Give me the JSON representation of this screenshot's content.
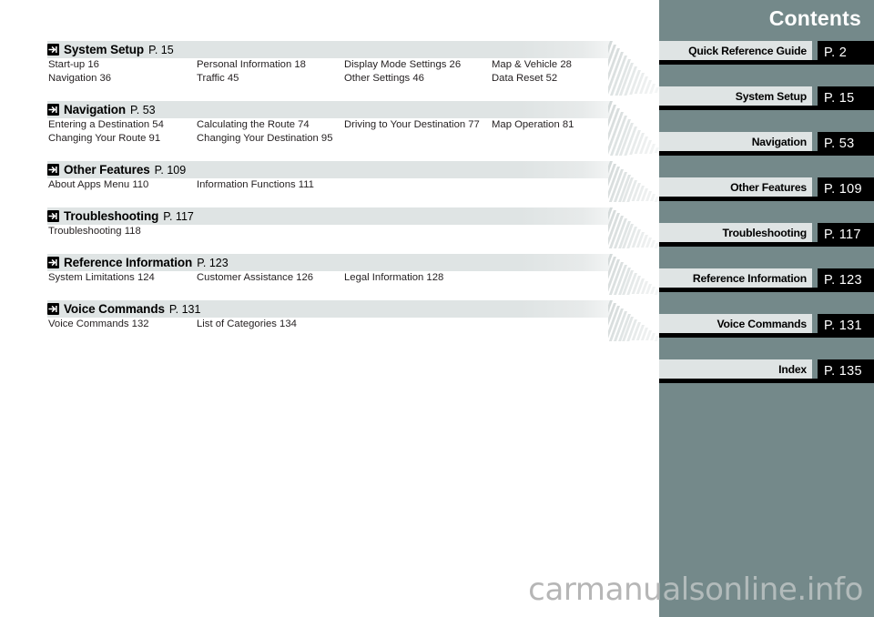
{
  "sidebar": {
    "title": "Contents",
    "background_color": "#74898a",
    "label_color": "#dfe4e4",
    "page_block_color": "#000000",
    "tabs": [
      {
        "label": "Quick Reference Guide",
        "page": "P. 2"
      },
      {
        "label": "System Setup",
        "page": "P. 15"
      },
      {
        "label": "Navigation",
        "page": "P. 53"
      },
      {
        "label": "Other Features",
        "page": "P. 109"
      },
      {
        "label": "Troubleshooting",
        "page": "P. 117"
      },
      {
        "label": "Reference Information",
        "page": "P. 123"
      },
      {
        "label": "Voice Commands",
        "page": "P. 131"
      },
      {
        "label": "Index",
        "page": "P. 135"
      }
    ]
  },
  "contents": {
    "sections": [
      {
        "icon": "jump-arrow-icon",
        "title": "System Setup",
        "page": "P. 15",
        "rows": [
          [
            "Start-up 16",
            "Personal Information 18",
            "Display Mode Settings 26",
            "Map & Vehicle 28"
          ],
          [
            "Navigation 36",
            "Traffic 45",
            "Other Settings 46",
            "Data Reset 52"
          ]
        ]
      },
      {
        "icon": "jump-arrow-icon",
        "title": "Navigation",
        "page": "P. 53",
        "rows": [
          [
            "Entering a Destination 54",
            "Calculating the Route 74",
            "Driving to Your Destination 77",
            "Map Operation 81"
          ],
          [
            "Changing Your Route 91",
            "Changing Your Destination 95",
            "",
            ""
          ]
        ]
      },
      {
        "icon": "jump-arrow-icon",
        "title": "Other Features",
        "page": "P. 109",
        "rows": [
          [
            "About Apps Menu 110",
            "Information Functions 111",
            "",
            ""
          ]
        ]
      },
      {
        "icon": "jump-arrow-icon",
        "title": "Troubleshooting",
        "page": "P. 117",
        "rows": [
          [
            "Troubleshooting 118",
            "",
            "",
            ""
          ]
        ]
      },
      {
        "icon": "jump-arrow-icon",
        "title": "Reference Information",
        "page": "P. 123",
        "rows": [
          [
            "System Limitations 124",
            "Customer Assistance 126",
            "Legal Information 128",
            ""
          ]
        ]
      },
      {
        "icon": "jump-arrow-icon",
        "title": "Voice Commands",
        "page": "P. 131",
        "rows": [
          [
            "Voice Commands 132",
            "List of Categories 134",
            "",
            ""
          ]
        ]
      }
    ]
  },
  "watermark": {
    "text": "carmanualsonline.info"
  }
}
